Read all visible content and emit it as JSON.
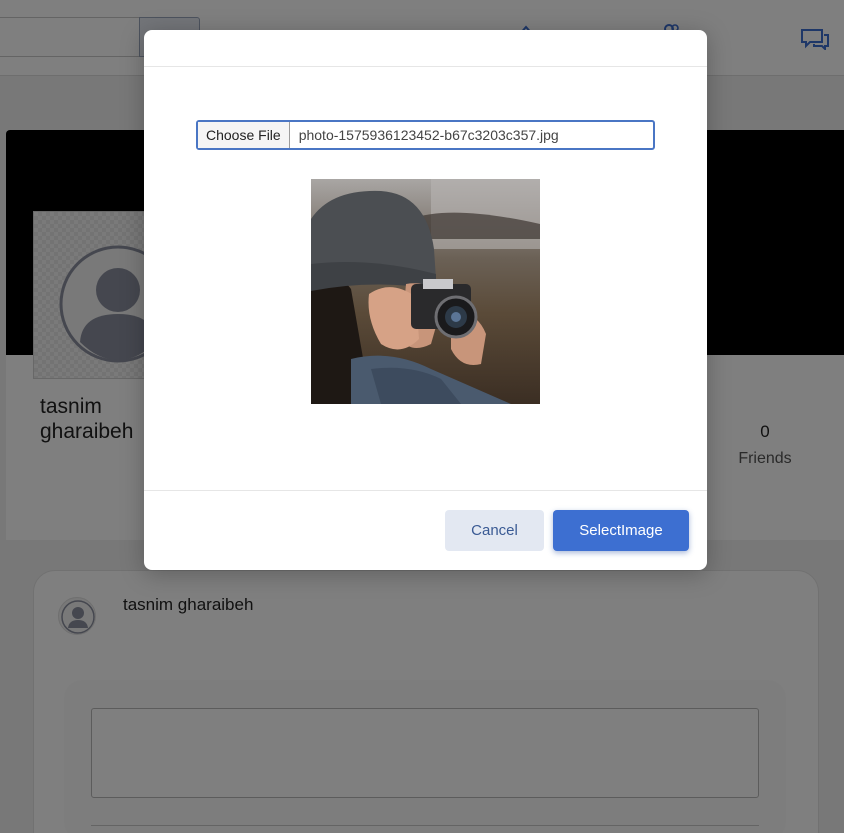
{
  "topbar": {
    "search_placeholder": "",
    "icons": [
      "search-icon",
      "home-icon",
      "friends-icon",
      "messages-icon"
    ]
  },
  "profile": {
    "name": "tasnim\ngharaibeh",
    "friends_count": "0",
    "friends_label": "Friends"
  },
  "post": {
    "author": "tasnim gharaibeh"
  },
  "modal": {
    "choose_file_label": "Choose File",
    "file_name": "photo-1575936123452-b67c3203c357.jpg",
    "cancel_label": "Cancel",
    "select_label": "SelectImage"
  },
  "colors": {
    "primary": "#3d6fd1",
    "cancel_bg": "#e3e8f2",
    "overlay": "rgba(0,0,0,0.5)"
  }
}
